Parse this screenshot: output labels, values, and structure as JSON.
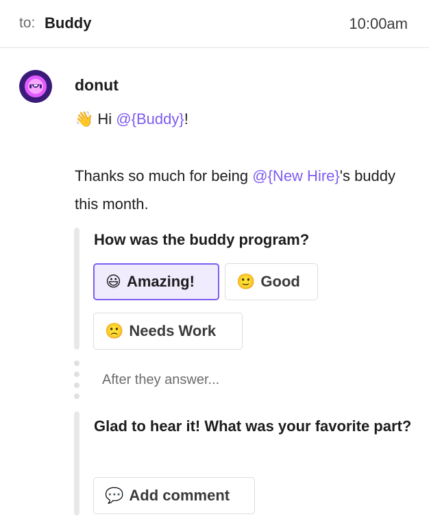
{
  "header": {
    "to_label": "to:",
    "recipient": "Buddy",
    "time": "10:00am"
  },
  "message": {
    "sender": "donut",
    "greeting": {
      "emoji": "👋",
      "prefix": "Hi ",
      "mention": "@{Buddy}",
      "suffix": "!"
    },
    "body": {
      "before": "Thanks so much for being ",
      "mention": "@{New Hire}",
      "after": "'s buddy this month."
    }
  },
  "survey": {
    "question": "How was the buddy program?",
    "options": [
      {
        "emoji": "😃",
        "label": "Amazing!",
        "selected": true
      },
      {
        "emoji": "🙂",
        "label": "Good",
        "selected": false
      },
      {
        "emoji": "🙁",
        "label": "Needs Work",
        "selected": false
      }
    ]
  },
  "after_text": "After they answer...",
  "followup": {
    "text": "Glad to hear it! What was your favorite part?",
    "button": {
      "emoji": "💬",
      "label": "Add comment"
    }
  },
  "colors": {
    "accent": "#7d5cf0",
    "avatar_bg": "#3b1b78",
    "avatar_face": "#e25bff"
  }
}
